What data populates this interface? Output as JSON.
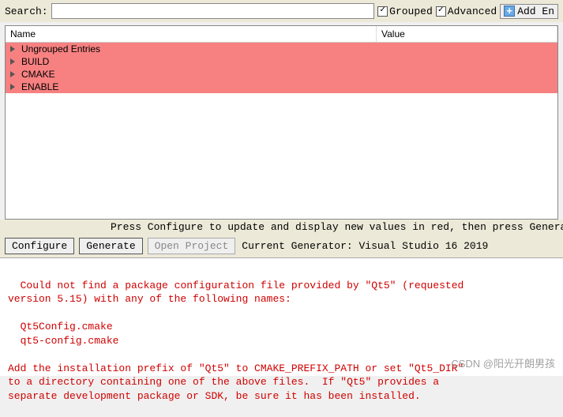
{
  "topbar": {
    "search_label": "Search:",
    "search_value": "",
    "grouped_label": "Grouped",
    "grouped_checked": true,
    "advanced_label": "Advanced",
    "advanced_checked": true,
    "add_entry_label": "Add En"
  },
  "cache": {
    "header_name": "Name",
    "header_value": "Value",
    "rows": [
      {
        "name": "Ungrouped Entries"
      },
      {
        "name": "BUILD"
      },
      {
        "name": "CMAKE"
      },
      {
        "name": "ENABLE"
      }
    ]
  },
  "hint": "Press Configure to update and display new values in red, then press Generate to generate select",
  "buttons": {
    "configure": "Configure",
    "generate": "Generate",
    "open_project": "Open Project",
    "generator_label": "Current Generator: Visual Studio 16 2019"
  },
  "log": "Could not find a package configuration file provided by \"Qt5\" (requested\nversion 5.15) with any of the following names:\n\n  Qt5Config.cmake\n  qt5-config.cmake\n\nAdd the installation prefix of \"Qt5\" to CMAKE_PREFIX_PATH or set \"Qt5_DIR\"\nto a directory containing one of the above files.  If \"Qt5\" provides a\nseparate development package or SDK, be sure it has been installed.",
  "watermark": "CSDN @阳光开朗男孩"
}
